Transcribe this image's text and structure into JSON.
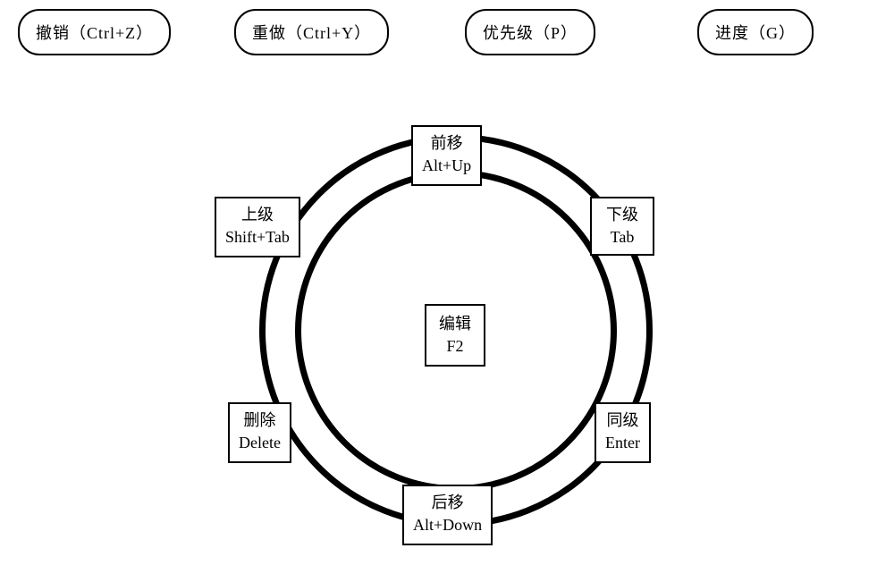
{
  "topButtons": {
    "undo": "撤销（Ctrl+Z）",
    "redo": "重做（Ctrl+Y）",
    "priority": "优先级（P）",
    "progress": "进度（G）"
  },
  "wheel": {
    "center": {
      "label": "编辑",
      "shortcut": "F2"
    },
    "top": {
      "label": "前移",
      "shortcut": "Alt+Up"
    },
    "bottom": {
      "label": "后移",
      "shortcut": "Alt+Down"
    },
    "upperLeft": {
      "label": "上级",
      "shortcut": "Shift+Tab"
    },
    "upperRight": {
      "label": "下级",
      "shortcut": "Tab"
    },
    "lowerLeft": {
      "label": "删除",
      "shortcut": "Delete"
    },
    "lowerRight": {
      "label": "同级",
      "shortcut": "Enter"
    }
  }
}
